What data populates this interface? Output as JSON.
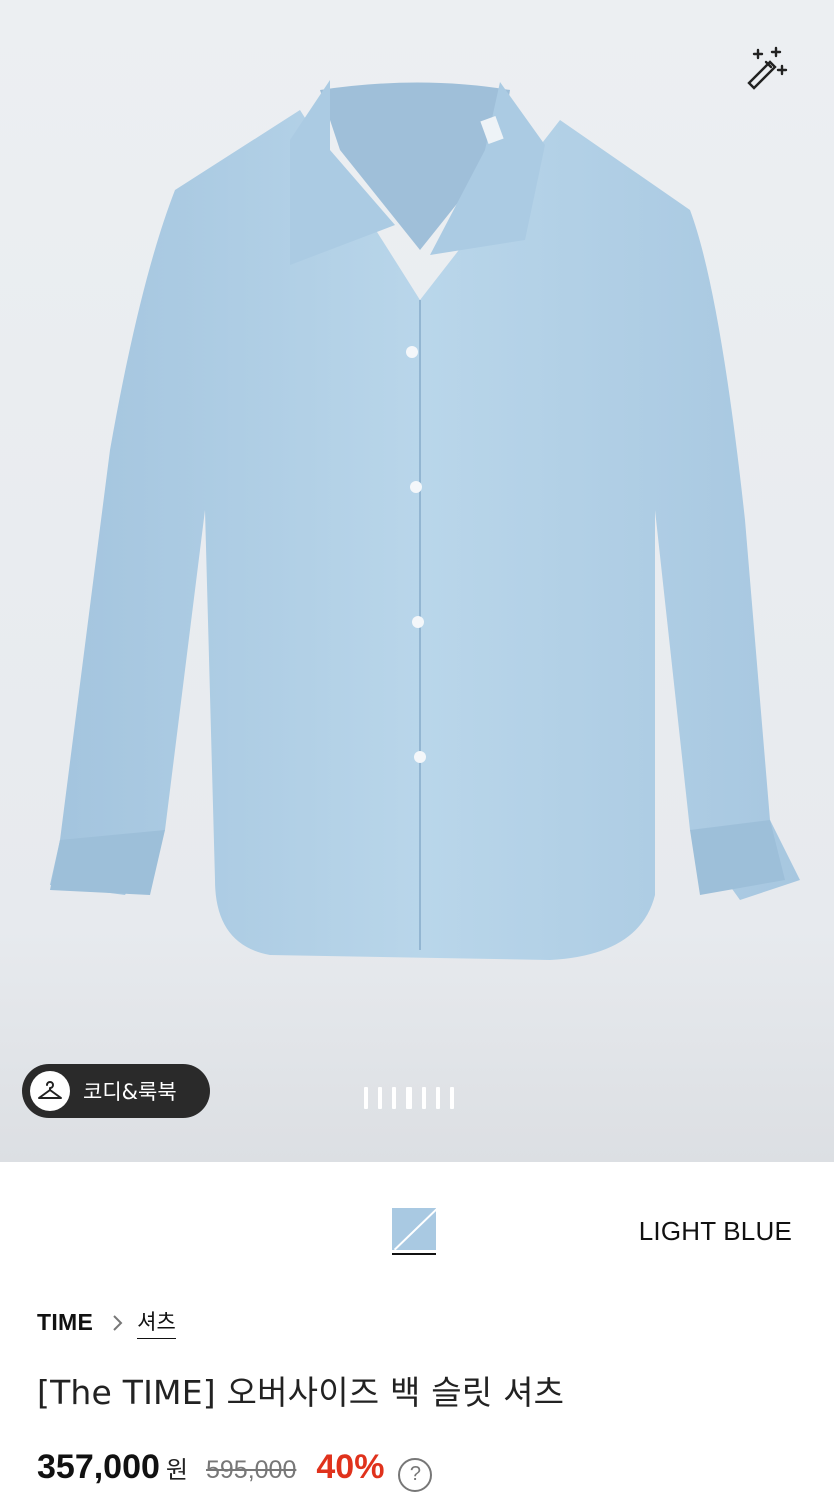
{
  "hero": {
    "coordi_label": "코디&룩북",
    "slides_total": 7,
    "slide_active_index": 4
  },
  "color": {
    "name": "LIGHT BLUE",
    "swatch_color": "#a9c9e2"
  },
  "product": {
    "brand": "TIME",
    "category": "셔츠",
    "title": "[The TIME] 오버사이즈 백 슬릿 셔츠",
    "price": "357,000",
    "currency": "원",
    "original_price": "595,000",
    "discount": "40%",
    "help_symbol": "?"
  },
  "colors": {
    "accent_red": "#e0321c",
    "shirt_blue": "#b4d2e8"
  },
  "icons": [
    "magic-wand-icon",
    "hanger-icon",
    "chevron-right-icon",
    "question-icon"
  ]
}
